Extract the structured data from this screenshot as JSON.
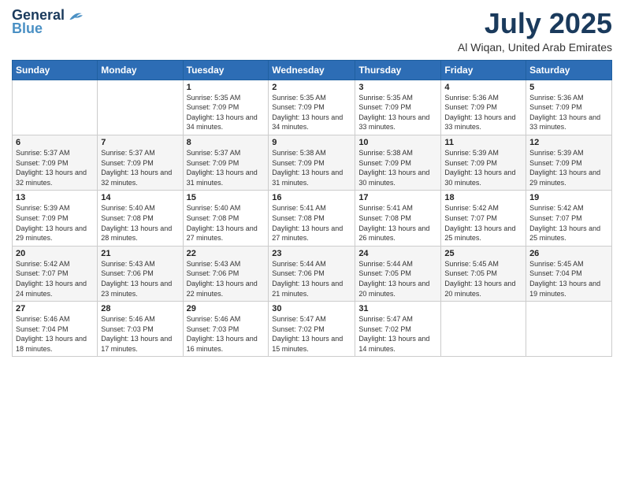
{
  "logo": {
    "line1": "General",
    "line2": "Blue"
  },
  "header": {
    "month": "July 2025",
    "location": "Al Wiqan, United Arab Emirates"
  },
  "days_of_week": [
    "Sunday",
    "Monday",
    "Tuesday",
    "Wednesday",
    "Thursday",
    "Friday",
    "Saturday"
  ],
  "weeks": [
    [
      {
        "day": "",
        "info": ""
      },
      {
        "day": "",
        "info": ""
      },
      {
        "day": "1",
        "info": "Sunrise: 5:35 AM\nSunset: 7:09 PM\nDaylight: 13 hours and 34 minutes."
      },
      {
        "day": "2",
        "info": "Sunrise: 5:35 AM\nSunset: 7:09 PM\nDaylight: 13 hours and 34 minutes."
      },
      {
        "day": "3",
        "info": "Sunrise: 5:35 AM\nSunset: 7:09 PM\nDaylight: 13 hours and 33 minutes."
      },
      {
        "day": "4",
        "info": "Sunrise: 5:36 AM\nSunset: 7:09 PM\nDaylight: 13 hours and 33 minutes."
      },
      {
        "day": "5",
        "info": "Sunrise: 5:36 AM\nSunset: 7:09 PM\nDaylight: 13 hours and 33 minutes."
      }
    ],
    [
      {
        "day": "6",
        "info": "Sunrise: 5:37 AM\nSunset: 7:09 PM\nDaylight: 13 hours and 32 minutes."
      },
      {
        "day": "7",
        "info": "Sunrise: 5:37 AM\nSunset: 7:09 PM\nDaylight: 13 hours and 32 minutes."
      },
      {
        "day": "8",
        "info": "Sunrise: 5:37 AM\nSunset: 7:09 PM\nDaylight: 13 hours and 31 minutes."
      },
      {
        "day": "9",
        "info": "Sunrise: 5:38 AM\nSunset: 7:09 PM\nDaylight: 13 hours and 31 minutes."
      },
      {
        "day": "10",
        "info": "Sunrise: 5:38 AM\nSunset: 7:09 PM\nDaylight: 13 hours and 30 minutes."
      },
      {
        "day": "11",
        "info": "Sunrise: 5:39 AM\nSunset: 7:09 PM\nDaylight: 13 hours and 30 minutes."
      },
      {
        "day": "12",
        "info": "Sunrise: 5:39 AM\nSunset: 7:09 PM\nDaylight: 13 hours and 29 minutes."
      }
    ],
    [
      {
        "day": "13",
        "info": "Sunrise: 5:39 AM\nSunset: 7:09 PM\nDaylight: 13 hours and 29 minutes."
      },
      {
        "day": "14",
        "info": "Sunrise: 5:40 AM\nSunset: 7:08 PM\nDaylight: 13 hours and 28 minutes."
      },
      {
        "day": "15",
        "info": "Sunrise: 5:40 AM\nSunset: 7:08 PM\nDaylight: 13 hours and 27 minutes."
      },
      {
        "day": "16",
        "info": "Sunrise: 5:41 AM\nSunset: 7:08 PM\nDaylight: 13 hours and 27 minutes."
      },
      {
        "day": "17",
        "info": "Sunrise: 5:41 AM\nSunset: 7:08 PM\nDaylight: 13 hours and 26 minutes."
      },
      {
        "day": "18",
        "info": "Sunrise: 5:42 AM\nSunset: 7:07 PM\nDaylight: 13 hours and 25 minutes."
      },
      {
        "day": "19",
        "info": "Sunrise: 5:42 AM\nSunset: 7:07 PM\nDaylight: 13 hours and 25 minutes."
      }
    ],
    [
      {
        "day": "20",
        "info": "Sunrise: 5:42 AM\nSunset: 7:07 PM\nDaylight: 13 hours and 24 minutes."
      },
      {
        "day": "21",
        "info": "Sunrise: 5:43 AM\nSunset: 7:06 PM\nDaylight: 13 hours and 23 minutes."
      },
      {
        "day": "22",
        "info": "Sunrise: 5:43 AM\nSunset: 7:06 PM\nDaylight: 13 hours and 22 minutes."
      },
      {
        "day": "23",
        "info": "Sunrise: 5:44 AM\nSunset: 7:06 PM\nDaylight: 13 hours and 21 minutes."
      },
      {
        "day": "24",
        "info": "Sunrise: 5:44 AM\nSunset: 7:05 PM\nDaylight: 13 hours and 20 minutes."
      },
      {
        "day": "25",
        "info": "Sunrise: 5:45 AM\nSunset: 7:05 PM\nDaylight: 13 hours and 20 minutes."
      },
      {
        "day": "26",
        "info": "Sunrise: 5:45 AM\nSunset: 7:04 PM\nDaylight: 13 hours and 19 minutes."
      }
    ],
    [
      {
        "day": "27",
        "info": "Sunrise: 5:46 AM\nSunset: 7:04 PM\nDaylight: 13 hours and 18 minutes."
      },
      {
        "day": "28",
        "info": "Sunrise: 5:46 AM\nSunset: 7:03 PM\nDaylight: 13 hours and 17 minutes."
      },
      {
        "day": "29",
        "info": "Sunrise: 5:46 AM\nSunset: 7:03 PM\nDaylight: 13 hours and 16 minutes."
      },
      {
        "day": "30",
        "info": "Sunrise: 5:47 AM\nSunset: 7:02 PM\nDaylight: 13 hours and 15 minutes."
      },
      {
        "day": "31",
        "info": "Sunrise: 5:47 AM\nSunset: 7:02 PM\nDaylight: 13 hours and 14 minutes."
      },
      {
        "day": "",
        "info": ""
      },
      {
        "day": "",
        "info": ""
      }
    ]
  ]
}
